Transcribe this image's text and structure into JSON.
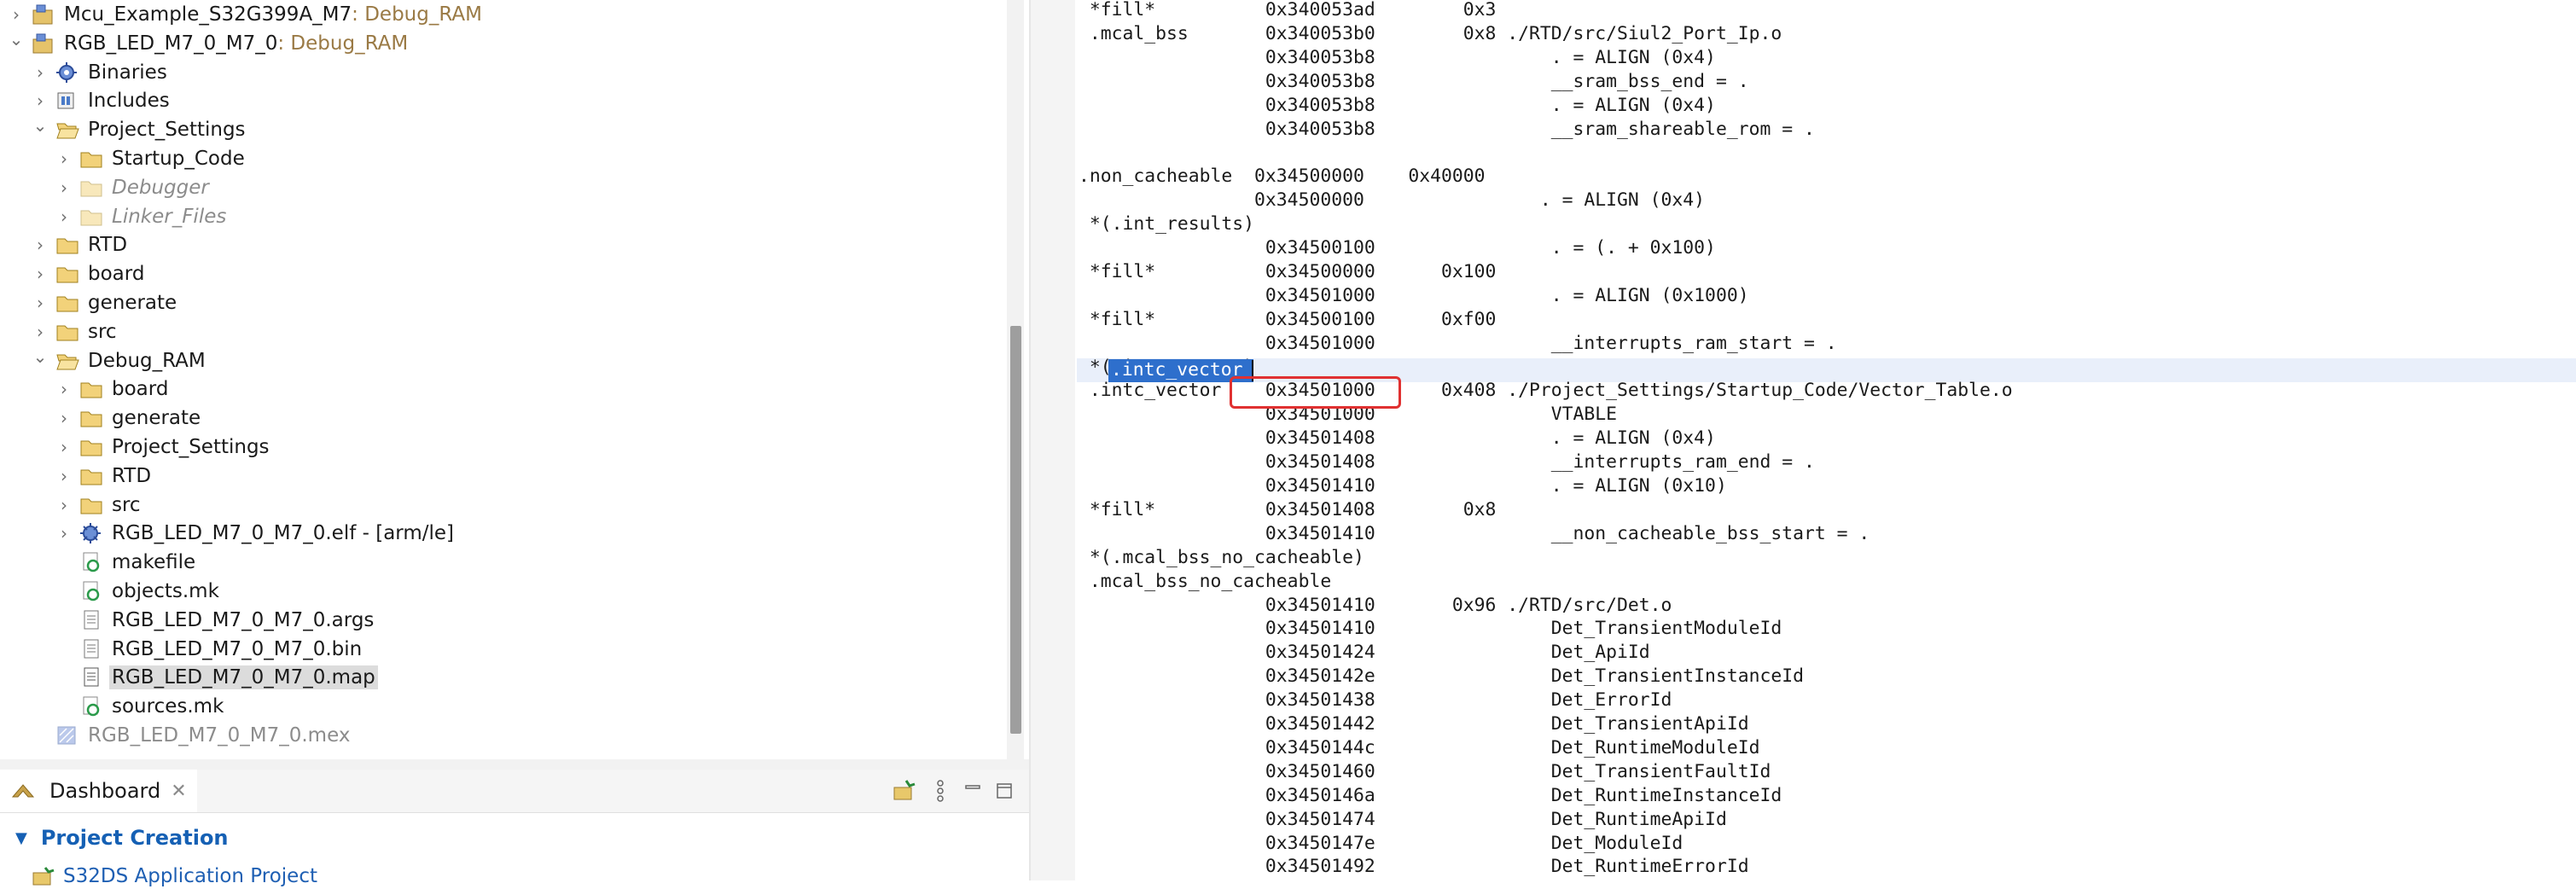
{
  "explorer": {
    "items": [
      {
        "label": "Mcu_Example_S32G399A_M7",
        "suffix": ": Debug_RAM",
        "icon": "project-icon",
        "expanded": false
      },
      {
        "label": "RGB_LED_M7_0_M7_0",
        "suffix": ": Debug_RAM",
        "icon": "project-icon",
        "expanded": true
      },
      {
        "label": "Binaries",
        "icon": "binaries-icon"
      },
      {
        "label": "Includes",
        "icon": "includes-icon"
      },
      {
        "label": "Project_Settings",
        "icon": "folder-open-icon",
        "expanded": true
      },
      {
        "label": "Startup_Code",
        "icon": "folder-icon"
      },
      {
        "label": "Debugger",
        "icon": "folder-icon",
        "dimmed": true
      },
      {
        "label": "Linker_Files",
        "icon": "folder-icon",
        "dimmed": true
      },
      {
        "label": "RTD",
        "icon": "folder-icon"
      },
      {
        "label": "board",
        "icon": "folder-icon"
      },
      {
        "label": "generate",
        "icon": "folder-icon"
      },
      {
        "label": "src",
        "icon": "folder-icon"
      },
      {
        "label": "Debug_RAM",
        "icon": "folder-open-icon",
        "expanded": true
      },
      {
        "label": "board",
        "icon": "folder-icon"
      },
      {
        "label": "generate",
        "icon": "folder-icon"
      },
      {
        "label": "Project_Settings",
        "icon": "folder-icon"
      },
      {
        "label": "RTD",
        "icon": "folder-icon"
      },
      {
        "label": "src",
        "icon": "folder-icon"
      },
      {
        "label": "RGB_LED_M7_0_M7_0.elf - [arm/le]",
        "icon": "elf-binary-icon"
      },
      {
        "label": "makefile",
        "icon": "make-file-icon"
      },
      {
        "label": "objects.mk",
        "icon": "make-file-icon"
      },
      {
        "label": "RGB_LED_M7_0_M7_0.args",
        "icon": "text-file-icon"
      },
      {
        "label": "RGB_LED_M7_0_M7_0.bin",
        "icon": "text-file-icon"
      },
      {
        "label": "RGB_LED_M7_0_M7_0.map",
        "icon": "map-file-icon",
        "selected": true
      },
      {
        "label": "sources.mk",
        "icon": "make-file-icon"
      },
      {
        "label": "RGB_LED_M7_0_M7_0.mex",
        "icon": "mex-file-icon",
        "dimmed": true
      }
    ]
  },
  "dashboard": {
    "tab_label": "Dashboard",
    "section_title": "Project Creation",
    "link_label": "S32DS Application Project"
  },
  "editor": {
    "selected_text": ".intc_vector",
    "highlighted_address": "0x34501000",
    "lines": [
      " *fill*          0x340053ad        0x3",
      " .mcal_bss       0x340053b0        0x8 ./RTD/src/Siul2_Port_Ip.o",
      "                 0x340053b8                . = ALIGN (0x4)",
      "                 0x340053b8                __sram_bss_end = .",
      "                 0x340053b8                . = ALIGN (0x4)",
      "                 0x340053b8                __sram_shareable_rom = .",
      "",
      ".non_cacheable  0x34500000    0x40000",
      "                0x34500000                . = ALIGN (0x4)",
      " *(.int_results)",
      "                 0x34500100                . = (. + 0x100)",
      " *fill*          0x34500000      0x100",
      "                 0x34501000                . = ALIGN (0x1000)",
      " *fill*          0x34500100      0xf00",
      "                 0x34501000                __interrupts_ram_start = .",
      " *(.intc_vector)",
      " .intc_vector    0x34501000      0x408 ./Project_Settings/Startup_Code/Vector_Table.o",
      "                 0x34501000                VTABLE",
      "                 0x34501408                . = ALIGN (0x4)",
      "                 0x34501408                __interrupts_ram_end = .",
      "                 0x34501410                . = ALIGN (0x10)",
      " *fill*          0x34501408        0x8",
      "                 0x34501410                __non_cacheable_bss_start = .",
      " *(.mcal_bss_no_cacheable)",
      " .mcal_bss_no_cacheable",
      "                 0x34501410       0x96 ./RTD/src/Det.o",
      "                 0x34501410                Det_TransientModuleId",
      "                 0x34501424                Det_ApiId",
      "                 0x3450142e                Det_TransientInstanceId",
      "                 0x34501438                Det_ErrorId",
      "                 0x34501442                Det_TransientApiId",
      "                 0x3450144c                Det_RuntimeModuleId",
      "                 0x34501460                Det_TransientFaultId",
      "                 0x3450146a                Det_RuntimeInstanceId",
      "                 0x34501474                Det_RuntimeApiId",
      "                 0x3450147e                Det_ModuleId",
      "                 0x34501492                Det_RuntimeErrorId"
    ]
  }
}
